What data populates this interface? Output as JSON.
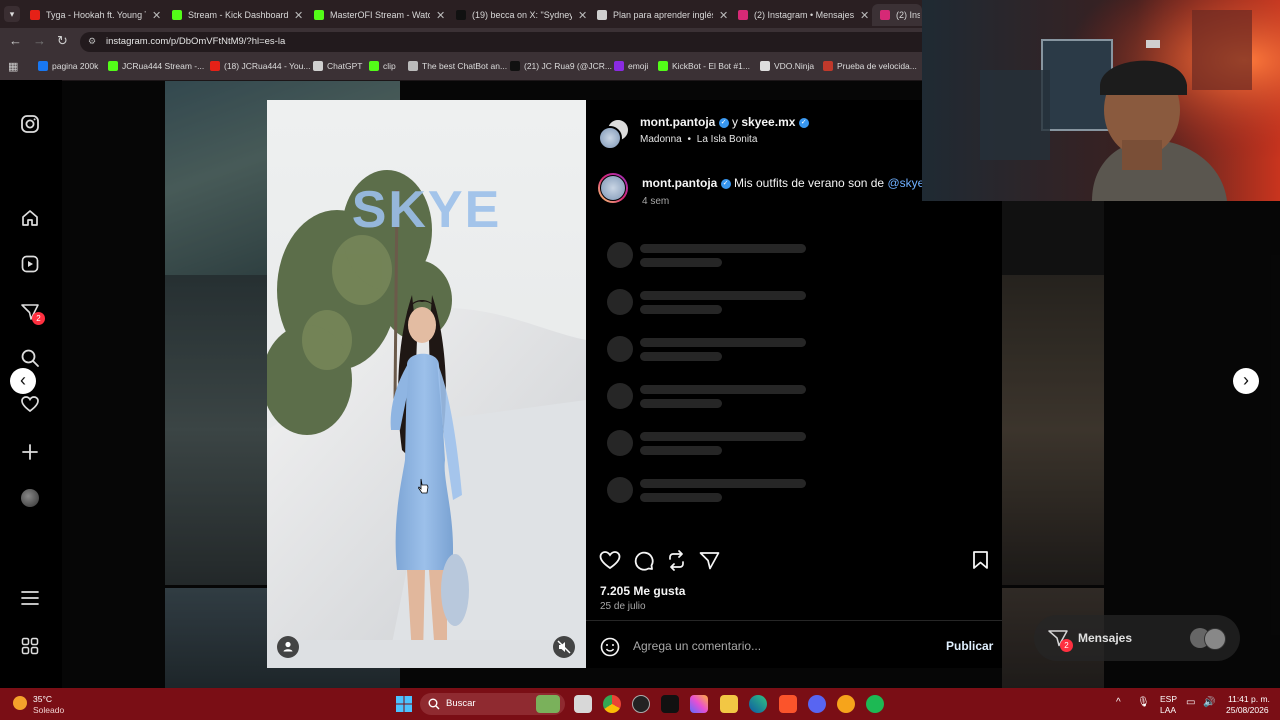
{
  "browser": {
    "tabs": [
      {
        "title": "Tyga - Hookah ft. Young T",
        "fav_color": "#e62117"
      },
      {
        "title": "Stream - Kick Dashboard",
        "fav_color": "#53fc18"
      },
      {
        "title": "MasterOFI Stream - Watch",
        "fav_color": "#53fc18"
      },
      {
        "title": "(19) becca on X: \"Sydney S",
        "fav_color": "#111111"
      },
      {
        "title": "Plan para aprender inglés",
        "fav_color": "#cfcfcf"
      },
      {
        "title": "(2) Instagram • Mensajes",
        "fav_color": "#d62976"
      },
      {
        "title": "(2) Inst",
        "fav_color": "#d62976"
      }
    ],
    "url": "instagram.com/p/DbOmVFtNtM9/?hl=es-la",
    "bookmarks": [
      {
        "label": "pagina 200k",
        "color": "#1877f2"
      },
      {
        "label": "JCRua444 Stream -...",
        "color": "#53fc18"
      },
      {
        "label": "(18) JCRua444 - You...",
        "color": "#e62117"
      },
      {
        "label": "ChatGPT",
        "color": "#cfcfcf"
      },
      {
        "label": "clip",
        "color": "#53fc18"
      },
      {
        "label": "The best ChatBot an...",
        "color": "#bbbbbb"
      },
      {
        "label": "(21) JC Rua9 (@JCR...",
        "color": "#111111"
      },
      {
        "label": "emoji",
        "color": "#8a2be2"
      },
      {
        "label": "KickBot - El Bot #1...",
        "color": "#53fc18"
      },
      {
        "label": "VDO.Ninja",
        "color": "#dddddd"
      },
      {
        "label": "Prueba de velocida...",
        "color": "#c0392b"
      }
    ]
  },
  "instagram": {
    "notification_count": "2",
    "media": {
      "brand_text": "SKYE"
    },
    "header": {
      "user1": "mont.pantoja",
      "joiner": "y",
      "user2": "skyee.mx",
      "audio": "Madonna",
      "location": "La Isla Bonita"
    },
    "caption": {
      "user": "mont.pantoja",
      "text": "Mis outfits de verano son de",
      "mention": "@skyee.",
      "time": "4 sem"
    },
    "likes": "7.205 Me gusta",
    "date": "25 de julio",
    "comment_placeholder": "Agrega un comentario...",
    "publish_label": "Publicar",
    "messages_label": "Mensajes",
    "messages_count": "2"
  },
  "taskbar": {
    "weather_temp": "35°C",
    "weather_desc": "Soleado",
    "search_label": "Buscar",
    "lang_top": "ESP",
    "lang_bottom": "LAA",
    "time": "11:41 p. m.",
    "date": "25/08/2026"
  },
  "colors": {
    "accent_blue": "#0095f6",
    "verified": "#3897f0",
    "taskbar": "#7a0e15"
  }
}
